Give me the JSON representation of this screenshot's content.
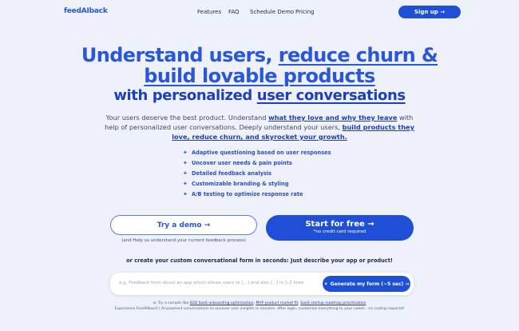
{
  "nav": {
    "logo": "feedAIback",
    "links": [
      "Features",
      "FAQ",
      "Schedule Demo",
      "Pricing"
    ],
    "signup_label": "Sign up →"
  },
  "hero": {
    "line1_plain": "Understand users, ",
    "line1_underlined": "reduce churn &",
    "line2_underlined": "build lovable products",
    "line3_plain": "with personalized ",
    "line3_underlined": "user conversations"
  },
  "subtitle": {
    "p1": "Your users deserve the best product. Understand ",
    "b1": "what they love and why they leave",
    "p2": " with help of personalized user conversations. Deeply understand your users, ",
    "b2": "build products they love, reduce churn, and skyrocket your growth."
  },
  "features": [
    "Adaptive questioning based on user responses",
    "Uncover user needs & pain points",
    "Detailed feedback analysis",
    "Customizable branding & styling",
    "A/B testing to optimize response rate"
  ],
  "cta": {
    "demo_label": "Try a demo →",
    "demo_note": "(and Help us understand your current feedback process)",
    "start_label": "Start for free →",
    "start_note": "*no credit card required"
  },
  "create_prompt": "or create your custom conversational form in seconds: Just describe your app or product!",
  "prompt_input": {
    "value": "",
    "placeholder": "e.g. Feedback form about an app which allows users to [...] and also [...] in 1-2 lines"
  },
  "generate_label": "Generate my form (~5 sec) →",
  "samples": {
    "prefix": "or Try a sample like ",
    "s1": "B2B SaaS onboarding optimization",
    "s2": "MVP product market fit",
    "s3": "SaaS startup roadmap prioritization"
  },
  "experience_note": "Experience FeedAIback's AI-powered conversations to uncover user insights in minutes. After login, customize everything to your needs - no coding required!",
  "colors": {
    "brand": "#1e4fd6",
    "heading": "#2a57d9",
    "background": "#eef1f9"
  },
  "icons": {
    "feature_bullet": "sparkle-icon",
    "generate": "sparkle-icon"
  }
}
